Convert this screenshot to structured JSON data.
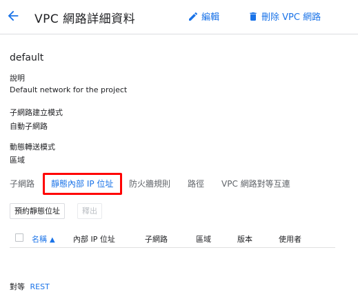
{
  "header": {
    "title": "VPC 網路詳細資料",
    "edit_label": "編輯",
    "delete_label": "刪除 VPC 網路"
  },
  "network": {
    "name": "default",
    "properties": [
      {
        "label": "說明",
        "value": "Default network for the project"
      },
      {
        "label": "子網路建立模式",
        "value": "自動子網路"
      },
      {
        "label": "動態轉送模式",
        "value": "區域"
      }
    ]
  },
  "tabs": [
    {
      "label": "子網路",
      "active": false
    },
    {
      "label": "靜態內部 IP 位址",
      "active": true
    },
    {
      "label": "防火牆規則",
      "active": false
    },
    {
      "label": "路徑",
      "active": false
    },
    {
      "label": "VPC 網路對等互連",
      "active": false
    }
  ],
  "actions": {
    "reserve_label": "預約靜態位址",
    "release_label": "釋出"
  },
  "table": {
    "columns": [
      "名稱",
      "內部 IP 位址",
      "子網路",
      "區域",
      "版本",
      "使用者"
    ],
    "sorted_column": "名稱",
    "sort_direction": "ascending"
  },
  "peering": {
    "label": "對等",
    "link": "REST"
  },
  "colors": {
    "accent": "#1a73e8",
    "highlight": "#ff0000",
    "divider": "#dadce0"
  }
}
